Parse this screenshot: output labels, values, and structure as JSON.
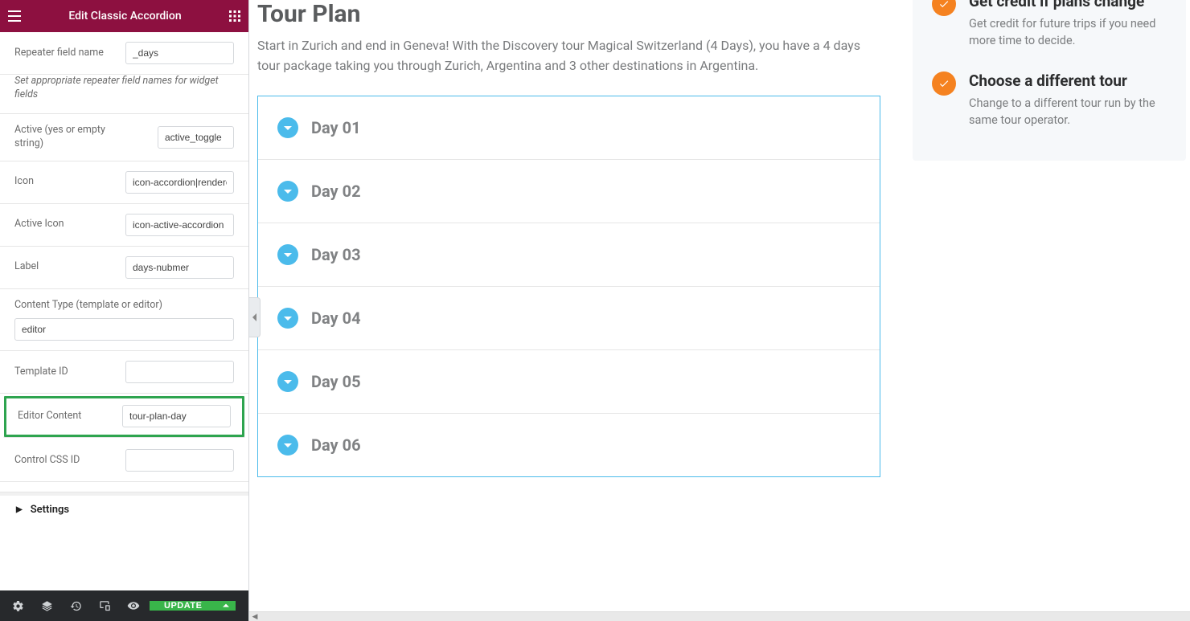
{
  "header": {
    "title": "Edit Classic Accordion"
  },
  "controls": {
    "repeater_name": {
      "label": "Repeater field name",
      "value": "_days"
    },
    "hint": "Set appropriate repeater field names for widget fields",
    "active": {
      "label": "Active (yes or empty string)",
      "value": "active_toggle"
    },
    "icon": {
      "label": "Icon",
      "value": "icon-accordion|rendered"
    },
    "active_icon": {
      "label": "Active Icon",
      "value": "icon-active-accordion"
    },
    "label_field": {
      "label": "Label",
      "value": "days-nubmer"
    },
    "content_type": {
      "label": "Content Type (template or editor)",
      "value": "editor"
    },
    "template_id": {
      "label": "Template ID",
      "value": ""
    },
    "editor_content": {
      "label": "Editor Content",
      "value": "tour-plan-day"
    },
    "css_id": {
      "label": "Control CSS ID",
      "value": ""
    }
  },
  "sections": {
    "settings": "Settings"
  },
  "footer": {
    "update": "UPDATE"
  },
  "preview": {
    "title": "Tour Plan",
    "lead": "Start in Zurich and end in Geneva! With the Discovery tour Magical Switzerland (4 Days), you have a 4 days tour package taking you through Zurich, Argentina and 3 other destinations in Argentina.",
    "days": [
      {
        "label": "Day 01"
      },
      {
        "label": "Day 02"
      },
      {
        "label": "Day 03"
      },
      {
        "label": "Day 04"
      },
      {
        "label": "Day 05"
      },
      {
        "label": "Day 06"
      }
    ]
  },
  "info": {
    "items": [
      {
        "title": "Get credit if plans change",
        "desc": "Get credit for future trips if you need more time to decide."
      },
      {
        "title": "Choose a different tour",
        "desc": "Change to a different tour run by the same tour operator."
      }
    ]
  }
}
